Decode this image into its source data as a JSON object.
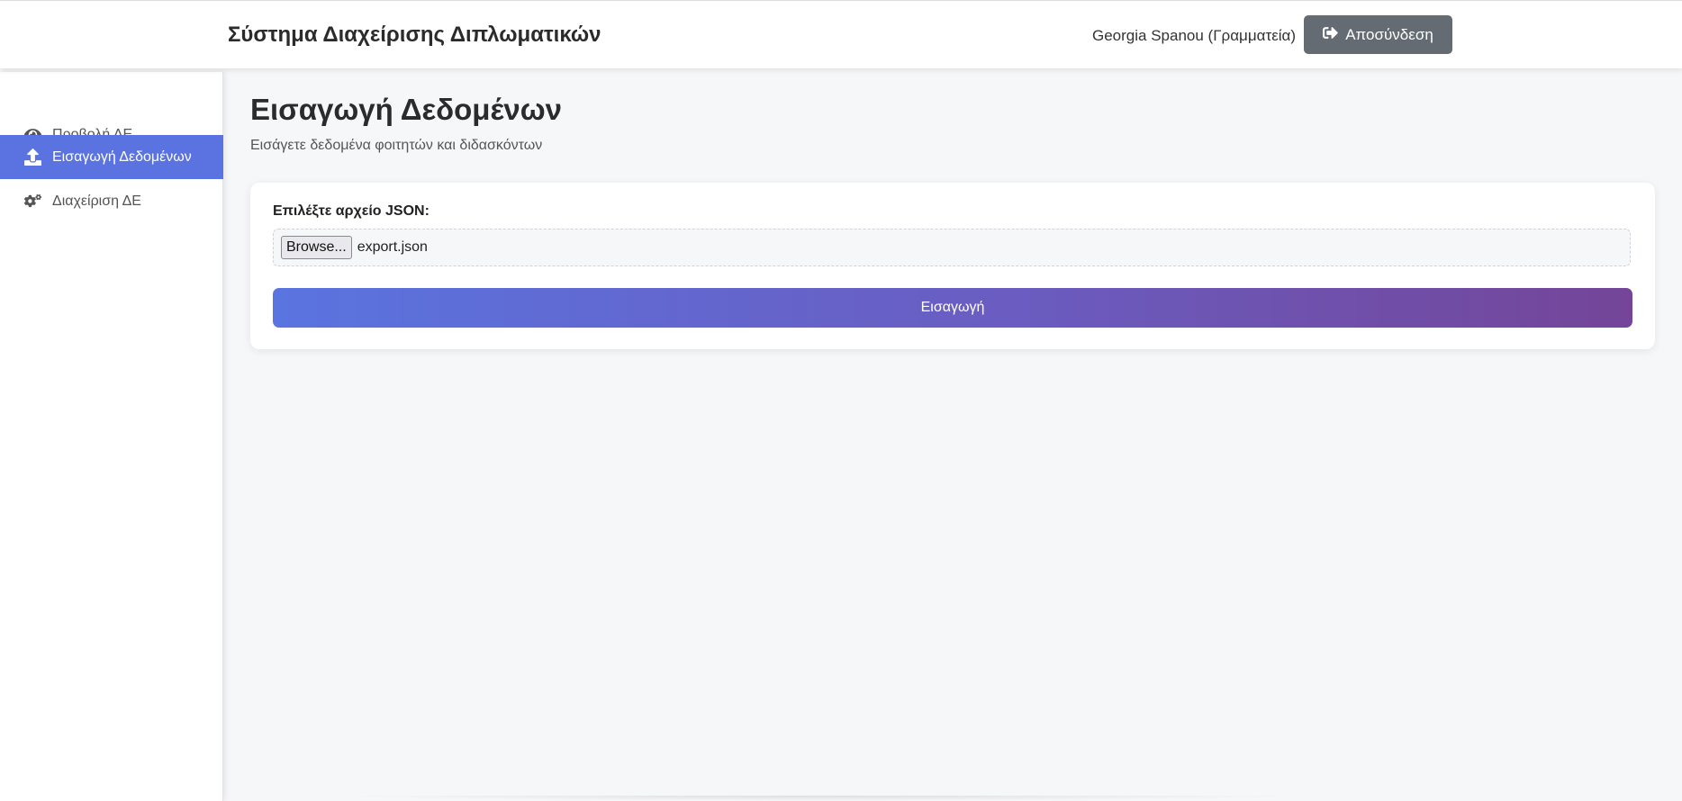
{
  "header": {
    "title": "Σύστημα Διαχείρισης Διπλωματικών",
    "user": "Georgia Spanou (Γραμματεία)",
    "logout_label": "Αποσύνδεση"
  },
  "sidebar": {
    "items": [
      {
        "label": "Προβολή ΔΕ",
        "icon": "eye-icon",
        "active": false
      },
      {
        "label": "Εισαγωγή Δεδομένων",
        "icon": "upload-icon",
        "active": true
      },
      {
        "label": "Διαχείριση ΔΕ",
        "icon": "cogs-icon",
        "active": false
      }
    ]
  },
  "main": {
    "title": "Εισαγωγή Δεδομένων",
    "subtitle": "Εισάγετε δεδομένα φοιτητών και διδασκόντων",
    "form": {
      "label": "Επιλέξτε αρχείο JSON:",
      "browse_label": "Browse...",
      "file_name": "export.json",
      "submit_label": "Εισαγωγή"
    }
  },
  "colors": {
    "accent": "#5b73e0",
    "logout_bg": "#646b72",
    "gradient_start": "#5a74e0",
    "gradient_end": "#744598"
  }
}
